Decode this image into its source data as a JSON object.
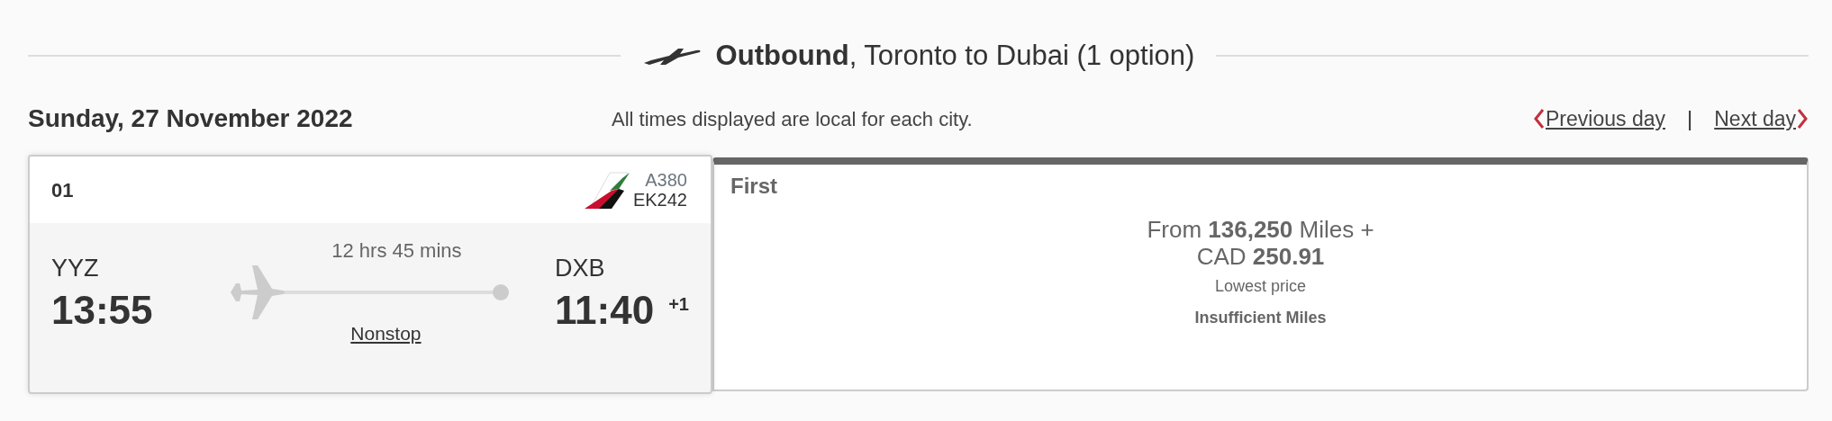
{
  "heading": {
    "title": "**Outbound**, Toronto to Dubai (1 option)"
  },
  "date": "Sunday, 27 November 2022",
  "note": "All times displayed are local for each city.",
  "day_nav": {
    "previous": "Previous day",
    "separator": "|",
    "next": "Next day"
  },
  "flight": {
    "number_label": "01",
    "aircraft": "A380",
    "flight_no": "EK242",
    "origin": "YYZ",
    "departure": "13:55",
    "duration": "12 hrs 45 mins",
    "stops": "Nonstop",
    "destination": "DXB",
    "arrival": "11:40",
    "day_offset": "+1"
  },
  "fare": {
    "cabin": "First",
    "price_lines": [
      "From **136,250** Miles +",
      "CAD **250.91**"
    ],
    "caption": "Lowest price",
    "status": "Insufficient Miles"
  }
}
